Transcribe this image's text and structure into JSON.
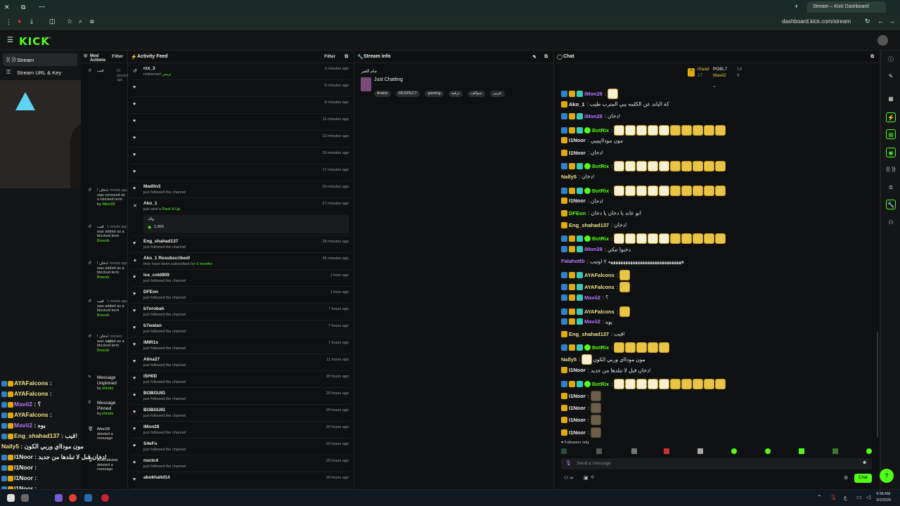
{
  "browser": {
    "tab_title": "Stream – Kick Dashboard",
    "url": "dashboard.kick.com/stream"
  },
  "app": {
    "logo": "KICK",
    "logo_sup": "BETA"
  },
  "sidebar": {
    "items": [
      {
        "label": "Stream",
        "icon": "broadcast-icon"
      },
      {
        "label": "Stream URL & Key",
        "icon": "key-icon"
      }
    ]
  },
  "mod_actions": {
    "title": "Mod Actions",
    "filter": "Filter",
    "items": [
      {
        "user": "قيب",
        "time": "51 seconds ago"
      },
      {
        "user": "! دخان",
        "action": "was removed as a blocked term",
        "by": "iMon28",
        "time": "1 minute ago"
      },
      {
        "user": "قيب",
        "action": "was added as a blocked term",
        "by": "Breexb",
        "time": "1 minute ago"
      },
      {
        "user": "! دخان",
        "action": "was added as a blocked term",
        "by": "Breexb",
        "time": "1 minute ago"
      },
      {
        "user": "قيب",
        "action": "was added as a blocked term",
        "by": "Breexb",
        "time": "1 minute ago"
      },
      {
        "user": "! دخان",
        "action": "was added as a blocked term",
        "by": "Breexb",
        "time": "2 minutes ago"
      },
      {
        "user": "Message Unpinned",
        "by": "khlodz"
      },
      {
        "user": "Message Pinned",
        "by": "khlodz"
      },
      {
        "user": "iMon28",
        "action": "deleted a message"
      },
      {
        "user": "AYAFalcons",
        "action": "deleted a message"
      }
    ]
  },
  "activity_feed": {
    "title": "Activity Feed",
    "filter": "Filter",
    "items": [
      {
        "name": "rzx_3",
        "sub": "redeemed",
        "extra": "تريس",
        "time": "3 minutes ago"
      },
      {
        "name": "",
        "sub": "",
        "time": "5 minutes ago"
      },
      {
        "name": "",
        "sub": "",
        "time": "6 minutes ago"
      },
      {
        "name": "",
        "sub": "",
        "time": "11 minutes ago"
      },
      {
        "name": "",
        "sub": "",
        "time": "12 minutes ago"
      },
      {
        "name": "",
        "sub": "",
        "time": "16 minutes ago"
      },
      {
        "name": "",
        "sub": "",
        "time": "17 minutes ago"
      },
      {
        "name": "Madlin3",
        "sub": "just followed the channel",
        "time": "20 minutes ago"
      },
      {
        "name": "Ako_1",
        "sub": "just sent a",
        "extra": "Pack It Up",
        "time": "27 minutes ago",
        "note": "ولك",
        "amount": "1,000"
      },
      {
        "name": "Eng_shahad137",
        "sub": "just followed the channel",
        "time": "28 minutes ago"
      },
      {
        "name": "Ako_1 Resubscribed!",
        "sub": "they have been subscribed for",
        "extra": "5 months",
        "time": "45 minutes ago"
      },
      {
        "name": "ice_cold909",
        "sub": "just followed the channel",
        "time": "1 hour ago"
      },
      {
        "name": "DFEon",
        "sub": "just followed the channel",
        "time": "1 hour ago"
      },
      {
        "name": "b7orobah",
        "sub": "just followed the channel",
        "time": "7 hours ago"
      },
      {
        "name": "b7watan",
        "sub": "just followed the channel",
        "time": "7 hours ago"
      },
      {
        "name": "iMIR1x",
        "sub": "just followed the channel",
        "time": "7 hours ago"
      },
      {
        "name": "Alina27",
        "sub": "just followed the channel",
        "time": "11 hours ago"
      },
      {
        "name": "iSH0D",
        "sub": "just followed the channel",
        "time": "20 hours ago"
      },
      {
        "name": "BOBGUIG",
        "sub": "just followed the channel",
        "time": "20 hours ago"
      },
      {
        "name": "BOBGUIG",
        "sub": "just followed the channel",
        "time": "20 hours ago"
      },
      {
        "name": "iMon28",
        "sub": "just followed the channel",
        "time": "20 hours ago"
      },
      {
        "name": "S4eFo",
        "sub": "just followed the channel",
        "time": "20 hours ago"
      },
      {
        "name": "noctc4",
        "sub": "just followed the channel",
        "time": "20 hours ago"
      },
      {
        "name": "abokhalid14",
        "sub": "",
        "time": "20 hours ago"
      }
    ]
  },
  "stream_info": {
    "title": "Stream info",
    "stream_title": "مام الغير",
    "category": "Just Chatting",
    "tags": [
      "Arabic",
      "RESPECT",
      "gaming",
      "ترفيه",
      "سوالف",
      "عربي"
    ]
  },
  "chat": {
    "title": "Chat",
    "top_gifters": [
      {
        "rank": "1",
        "name": "iSaad",
        "count": "17"
      },
      {
        "rank": "2",
        "name": "PO8L7",
        "count": "14"
      },
      {
        "rank": "3",
        "name": "Mavii2",
        "count": "9"
      }
    ],
    "messages": [
      {
        "user": "iMon28",
        "color": "#b777ff",
        "text": "",
        "emotes": 1,
        "kind": "box"
      },
      {
        "user": "Ako_1",
        "color": "#eeeeee",
        "text": "كة الباند عن الكلمه يبي المترب طيب"
      },
      {
        "user": "iMon28",
        "color": "#b777ff",
        "text": "دخان!"
      },
      {
        "user": "BotRix",
        "color": "#53fc18",
        "text": "",
        "emotes": 10
      },
      {
        "user": "I1Noor",
        "color": "#eeeeee",
        "text": "مون مودااپيييي"
      },
      {
        "user": "I1Noor",
        "color": "#eeeeee",
        "text": "دخان!"
      },
      {
        "user": "BotRix",
        "color": "#53fc18",
        "text": "",
        "emotes": 10
      },
      {
        "user": "Nally5",
        "color": "#e9e38a",
        "text": "دخان!"
      },
      {
        "user": "BotRix",
        "color": "#53fc18",
        "text": "",
        "emotes": 10
      },
      {
        "user": "I1Noor",
        "color": "#eeeeee",
        "text": "دخان!"
      },
      {
        "user": "DFEon",
        "color": "#53fc18",
        "text": "ابو عابد يا دخان يا دخان"
      },
      {
        "user": "Eng_shahad137",
        "color": "#e9e38a",
        "text": "دخان!"
      },
      {
        "user": "BotRix",
        "color": "#53fc18",
        "text": "",
        "emotes": 10
      },
      {
        "user": "iMon28",
        "color": "#b777ff",
        "text": "دخنوا تبكي"
      },
      {
        "user": "Falahottb",
        "color": "#b777ff",
        "text": "ههههههههههههههههههههههههههههههه !! اوتيب"
      },
      {
        "user": "AYAFalcons",
        "color": "#e9e38a",
        "text": "",
        "emotes": 1
      },
      {
        "user": "AYAFalcons",
        "color": "#e9e38a",
        "text": "",
        "emotes": 1
      },
      {
        "user": "Mavii2",
        "color": "#b777ff",
        "text": "؟"
      },
      {
        "user": "AYAFalcons",
        "color": "#e9e38a",
        "text": "",
        "emotes": 1
      },
      {
        "user": "Mavii2",
        "color": "#b777ff",
        "text": "يوه"
      },
      {
        "user": "Eng_shahad137",
        "color": "#e9e38a",
        "text": "قيب!"
      },
      {
        "user": "BotRix",
        "color": "#53fc18",
        "text": "",
        "emotes": 5
      },
      {
        "user": "Nally5",
        "color": "#e9e38a",
        "text": "مون مودااي وربي الكون",
        "emotes": 1,
        "kind": "box"
      },
      {
        "user": "I1Noor",
        "color": "#eeeeee",
        "text": "دخان قبل لا تبلدها من جديد!"
      },
      {
        "user": "BotRix",
        "color": "#53fc18",
        "text": "",
        "emotes": 10
      },
      {
        "user": "I1Noor",
        "color": "#eeeeee",
        "text": "",
        "emotes": 1,
        "kind": "dark"
      },
      {
        "user": "I1Noor",
        "color": "#eeeeee",
        "text": "",
        "emotes": 1,
        "kind": "dark"
      },
      {
        "user": "I1Noor",
        "color": "#eeeeee",
        "text": "",
        "emotes": 1,
        "kind": "dark"
      },
      {
        "user": "I1Noor",
        "color": "#eeeeee",
        "text": "",
        "emotes": 1,
        "kind": "dark"
      }
    ],
    "followers_only": "Followers only",
    "input_placeholder": "Send a message",
    "viewer_count": "0",
    "send_label": "Chat"
  },
  "overlay_chat": [
    {
      "user": "AYAFalcons",
      "color": "#e9e38a",
      "text": ":"
    },
    {
      "user": "AYAFalcons",
      "color": "#e9e38a",
      "text": ":"
    },
    {
      "user": "Mavii2",
      "color": "#b777ff",
      "text": ": ؟"
    },
    {
      "user": "AYAFalcons",
      "color": "#e9e38a",
      "text": ":"
    },
    {
      "user": "Mavii2",
      "color": "#b777ff",
      "text": ": يوه"
    },
    {
      "user": "Eng_shahad137",
      "color": "#e9e38a",
      "text": ": قيب!"
    },
    {
      "user": "Nally5",
      "color": "#e9e38a",
      "text": ": مون مودااي وربي الكون"
    },
    {
      "user": "I1Noor",
      "color": "#eeeeee",
      "text": ": دخان قبل لا تبلدها من جديد!"
    },
    {
      "user": "I1Noor",
      "color": "#eeeeee",
      "text": ":"
    },
    {
      "user": "I1Noor",
      "color": "#eeeeee",
      "text": ":"
    },
    {
      "user": "I1Noor",
      "color": "#eeeeee",
      "text": ":"
    },
    {
      "user": "I1Noor",
      "color": "#eeeeee",
      "text": ":"
    }
  ],
  "taskbar": {
    "time": "4:58 AM",
    "date": "3/2/2026"
  }
}
